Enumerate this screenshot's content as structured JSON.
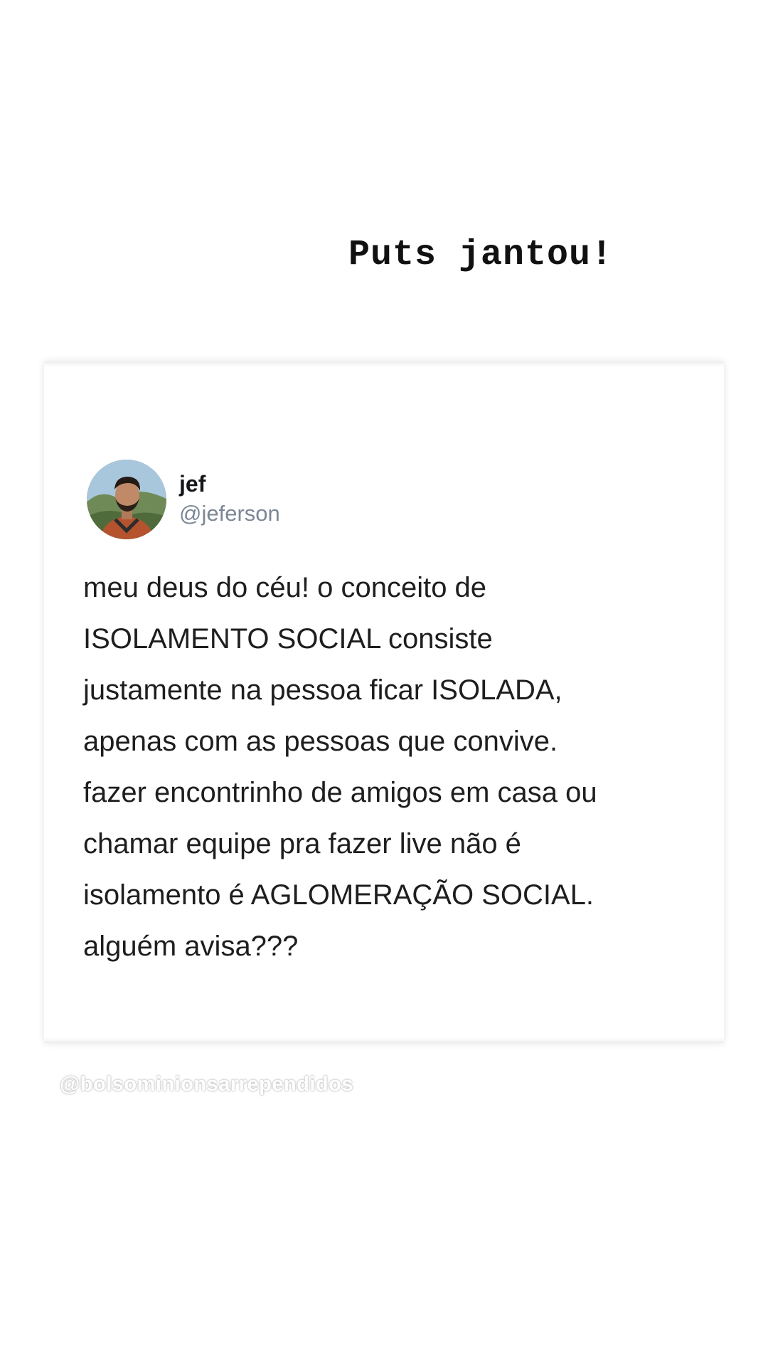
{
  "story": {
    "caption": "Puts jantou!"
  },
  "tweet": {
    "author_name": "jef",
    "author_handle": "@jeferson",
    "avatar_icon": "profile-photo-icon",
    "lines": [
      "meu deus do céu! o conceito de",
      "ISOLAMENTO SOCIAL consiste",
      "justamente na pessoa ficar ISOLADA,",
      "apenas com as pessoas que convive.",
      "fazer encontrinho de amigos em casa ou",
      "chamar equipe pra fazer live não é",
      "isolamento é AGLOMERAÇÃO SOCIAL.",
      "alguém avisa???"
    ]
  },
  "watermark": {
    "text": "@bolsominionsarrependidos"
  },
  "colors": {
    "background": "#ffffff",
    "text_primary": "#1e1e1e",
    "handle_gray": "#7b8794"
  }
}
